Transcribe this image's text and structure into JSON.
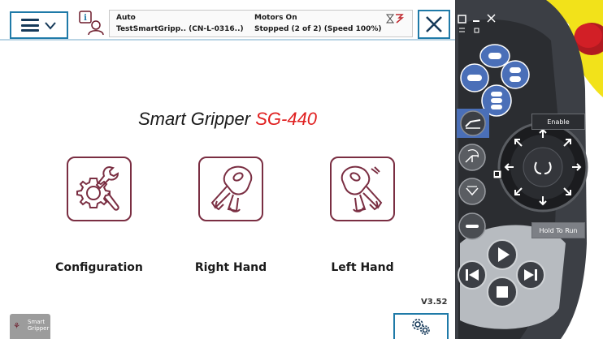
{
  "header": {
    "mode": "Auto",
    "task": "TestSmartGripp.. (CN-L-0316..)",
    "motors": "Motors On",
    "run_state": "Stopped (2 of 2) (Speed 100%)"
  },
  "app": {
    "title": "Smart Gripper",
    "model": "SG-440",
    "version": "V3.52"
  },
  "tiles": [
    {
      "label": "Configuration",
      "icon": "gear-wrench-icon"
    },
    {
      "label": "Right Hand",
      "icon": "right-hand-gripper-icon"
    },
    {
      "label": "Left Hand",
      "icon": "left-hand-gripper-icon"
    }
  ],
  "taskbar": {
    "item_line1": "Smart",
    "item_line2": "Gripper"
  },
  "pendant": {
    "enable_label": "Enable",
    "hold_label": "Hold To Run"
  },
  "colors": {
    "accent": "#1f7aa8",
    "tile_border": "#7a2e42",
    "model_red": "#e02020",
    "pendant_body": "#3c3f45",
    "pendant_button": "#4a6fb8",
    "emergency_stop": "#d21f26",
    "housing_yellow": "#f2e21a"
  }
}
